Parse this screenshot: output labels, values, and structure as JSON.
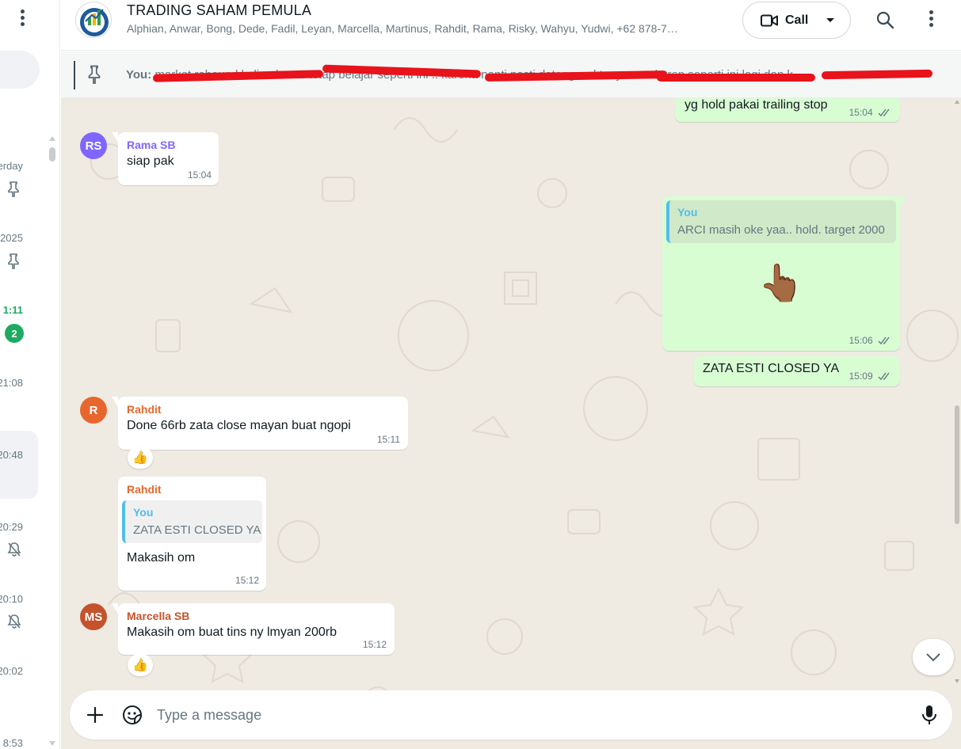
{
  "left_panel": {
    "chat_times": [
      "erday",
      "2025",
      "1:11",
      "21:08",
      "20:48",
      "20:29",
      "20:10",
      "20:02",
      "8:53"
    ],
    "unread_count": "2"
  },
  "header": {
    "title": "TRADING SAHAM PEMULA",
    "members": "Alphian, Anwar, Bong, Dede, Fadil, Leyan, Marcella, Martinus, Rahdit, Rama, Risky, Wahyu, Yudwi, +62 878-7…",
    "call_label": "Call"
  },
  "pinned": {
    "author": "You:",
    "text": " market rebound kalian harus tetap belajar seperti ini .. karena nanti pasti datang waktunya untuk trop seperti ini lagi dan k…"
  },
  "messages": {
    "m1": {
      "text": "yg hold pakai trailing stop",
      "time": "15:04"
    },
    "m2": {
      "avatar": "RS",
      "sender": "Rama SB",
      "text": "siap pak",
      "time": "15:04"
    },
    "m3": {
      "quote_author": "You",
      "quote_text": "ARCI masih oke yaa.. hold. target 2000",
      "emoji": "👆🏾",
      "time": "15:06"
    },
    "m4": {
      "text": "ZATA ESTI CLOSED YA",
      "time": "15:09"
    },
    "m5": {
      "avatar": "R",
      "sender": "Rahdit",
      "text": "Done 66rb zata close mayan buat ngopi",
      "time": "15:11",
      "reaction": "👍"
    },
    "m6": {
      "sender": "Rahdit",
      "quote_author": "You",
      "quote_text": "ZATA ESTI CLOSED YA",
      "text": "Makasih om",
      "time": "15:12"
    },
    "m7": {
      "avatar": "MS",
      "sender": "Marcella SB",
      "text": "Makasih om buat tins ny lmyan 200rb",
      "time": "15:12",
      "reaction": "👍"
    }
  },
  "composer": {
    "placeholder": "Type a message"
  },
  "colors": {
    "outgoing_bubble": "#d9fdd3",
    "chat_background": "#efeae2",
    "rama_name": "#7f66ff",
    "rahdit_name": "#e26a2c",
    "marcella_name": "#c4532d",
    "quote_accent": "#53bdeb",
    "unread_badge": "#1daa61"
  },
  "icons": [
    "menu-dots-icon",
    "pin-icon",
    "mute-icon",
    "video-icon",
    "search-icon",
    "plus-icon",
    "sticker-icon",
    "mic-icon",
    "chevron-down-icon",
    "double-check-icon"
  ]
}
